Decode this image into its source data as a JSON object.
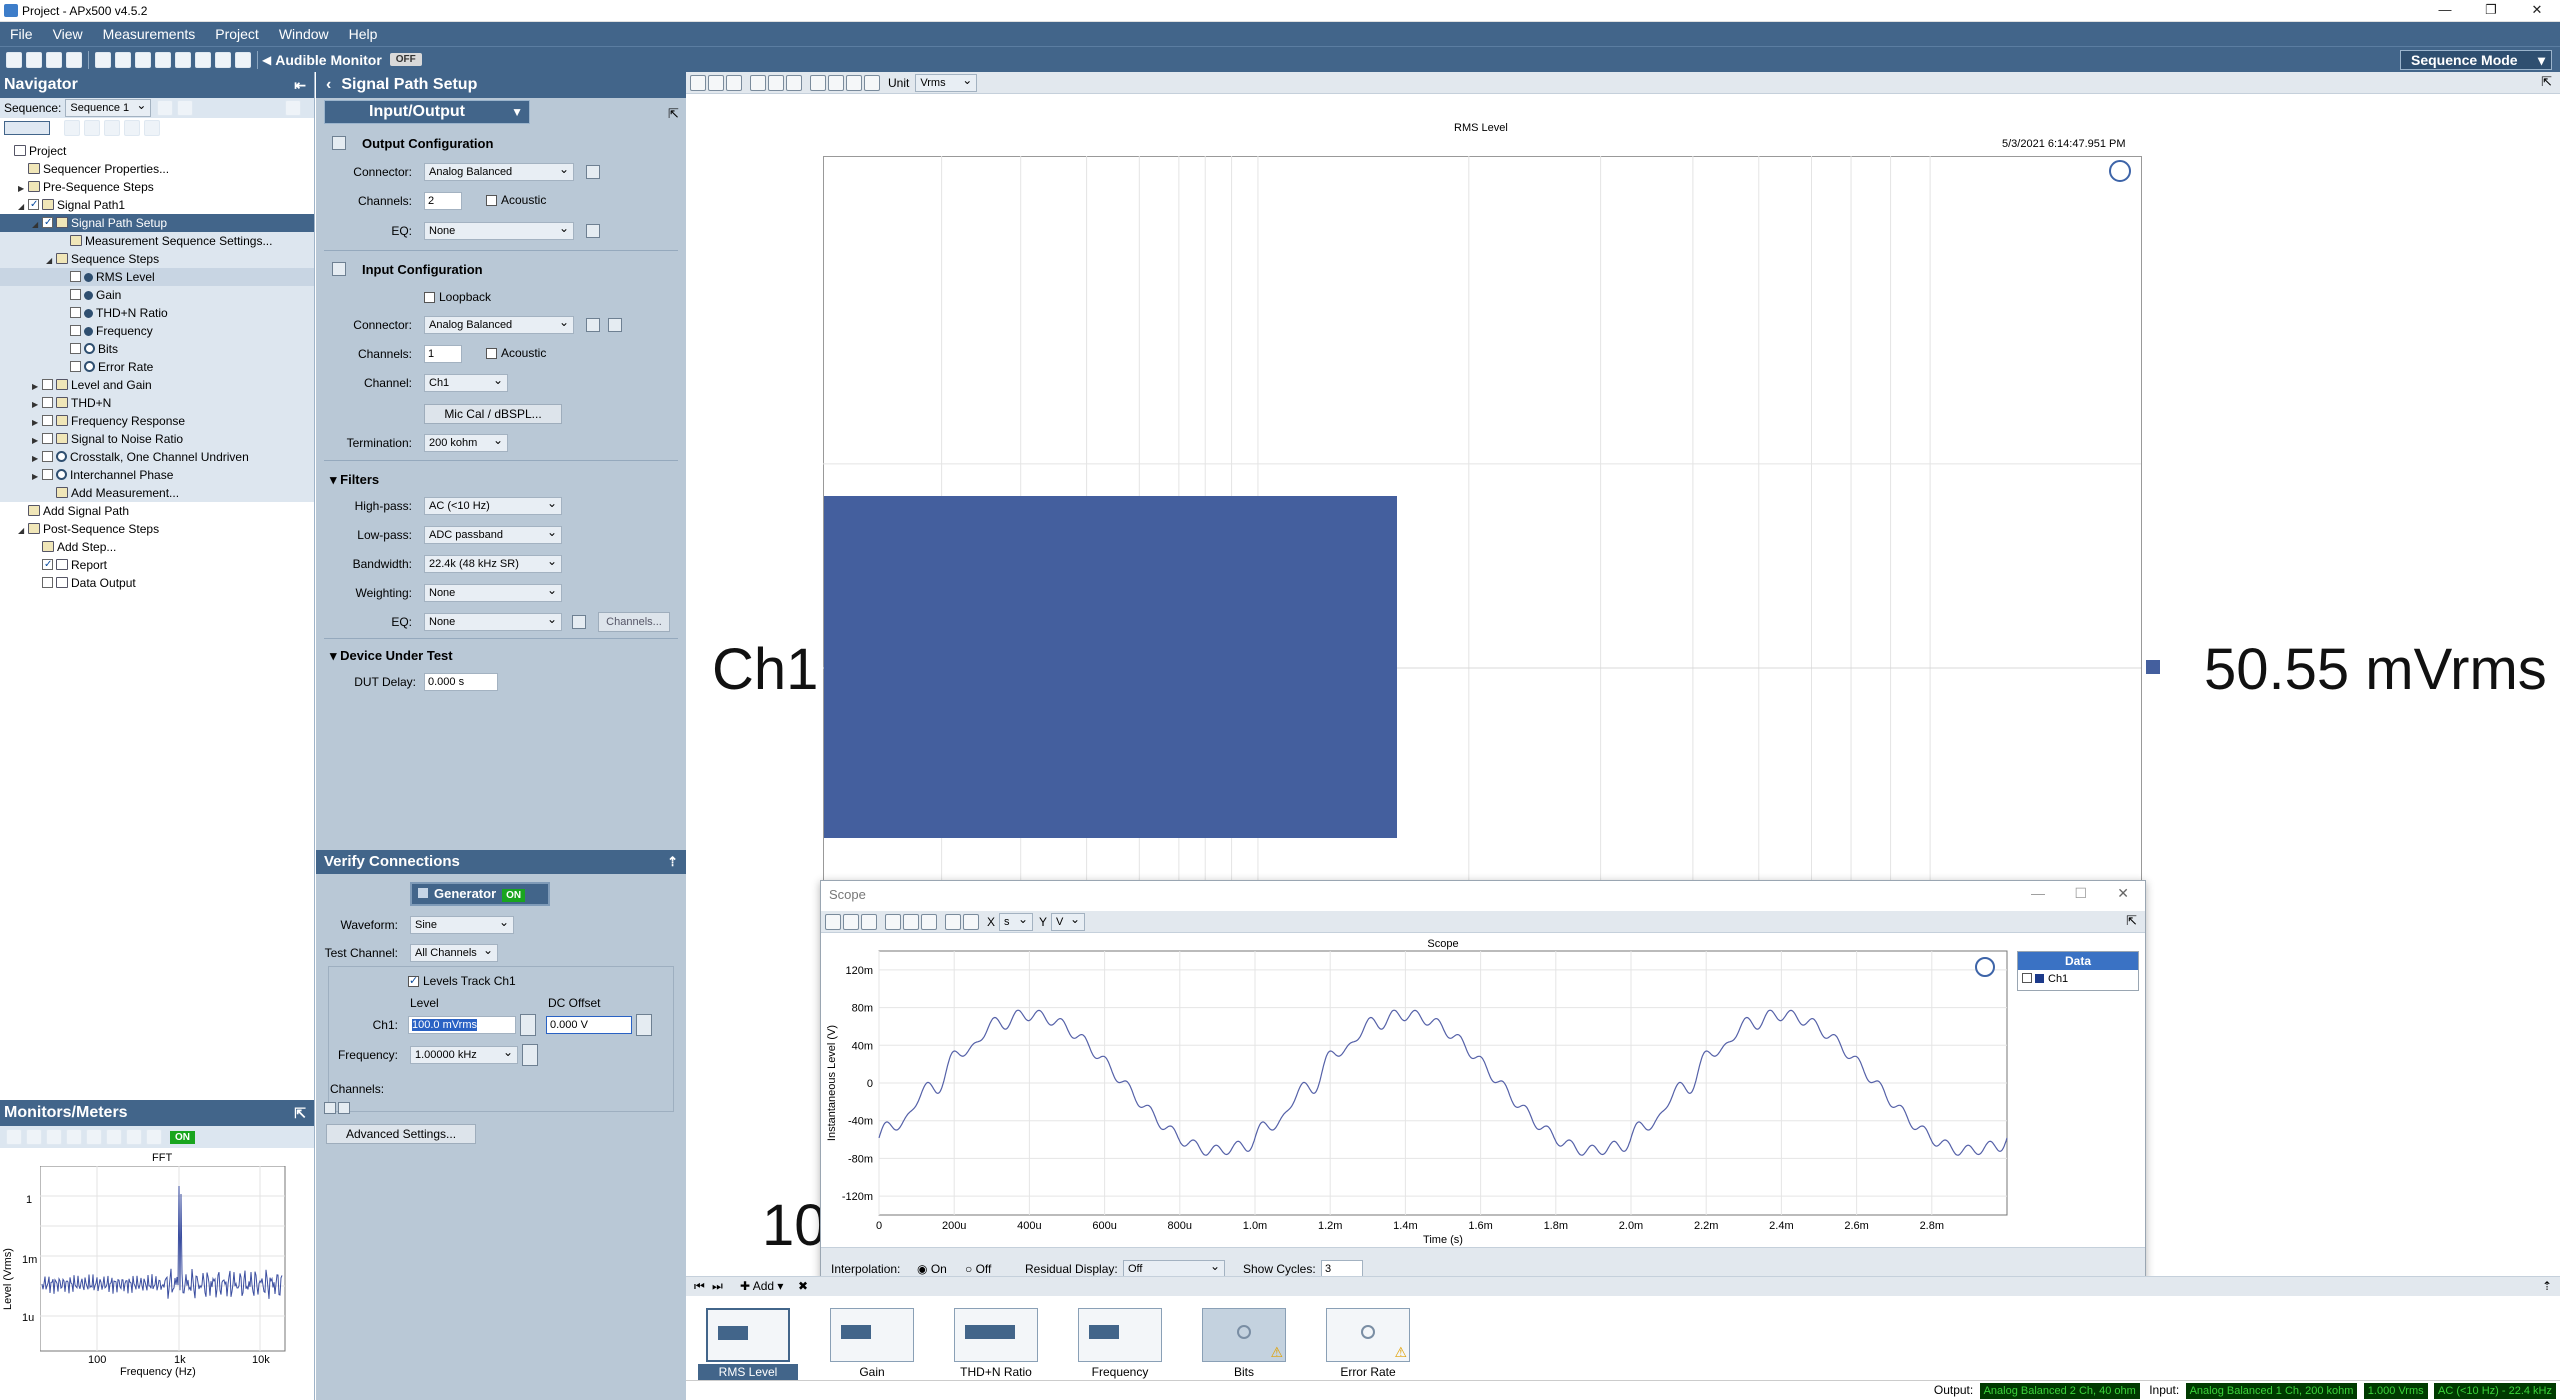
{
  "window": {
    "title": "Project - APx500 v4.5.2",
    "min": "—",
    "max": "❐",
    "close": "✕"
  },
  "menu": [
    "File",
    "View",
    "Measurements",
    "Project",
    "Window",
    "Help"
  ],
  "toolbar": {
    "audible_monitor": "Audible Monitor",
    "audible_state": "OFF",
    "mode": "Sequence Mode"
  },
  "navigator": {
    "title": "Navigator",
    "sequence_label": "Sequence:",
    "sequence_value": "Sequence 1",
    "tree": [
      {
        "label": "Project",
        "indent": 0,
        "arrow": "",
        "cb": false,
        "icon": "page"
      },
      {
        "label": "Sequencer Properties...",
        "indent": 1,
        "arrow": "",
        "cb": false,
        "icon": "gear"
      },
      {
        "label": "Pre-Sequence Steps",
        "indent": 1,
        "arrow": "▶",
        "cb": false,
        "icon": "folder"
      },
      {
        "label": "Signal Path1",
        "indent": 1,
        "arrow": "◢",
        "cb": true,
        "icon": "folder"
      },
      {
        "label": "Signal Path Setup",
        "indent": 2,
        "arrow": "◢",
        "cb": true,
        "icon": "folder",
        "state": "sel"
      },
      {
        "label": "Measurement Sequence Settings...",
        "indent": 4,
        "arrow": "",
        "cb": false,
        "icon": "gear",
        "state": "tinted"
      },
      {
        "label": "Sequence Steps",
        "indent": 3,
        "arrow": "◢",
        "cb": false,
        "icon": "folder",
        "state": "tinted"
      },
      {
        "label": "RMS Level",
        "indent": 4,
        "arrow": "",
        "cb": true,
        "icon": "dot",
        "state": "hl"
      },
      {
        "label": "Gain",
        "indent": 4,
        "arrow": "",
        "cb": true,
        "icon": "dot",
        "state": "tinted"
      },
      {
        "label": "THD+N Ratio",
        "indent": 4,
        "arrow": "",
        "cb": true,
        "icon": "dot",
        "state": "tinted"
      },
      {
        "label": "Frequency",
        "indent": 4,
        "arrow": "",
        "cb": true,
        "icon": "dot",
        "state": "tinted"
      },
      {
        "label": "Bits",
        "indent": 4,
        "arrow": "",
        "cb": true,
        "icon": "no",
        "state": "tinted"
      },
      {
        "label": "Error Rate",
        "indent": 4,
        "arrow": "",
        "cb": true,
        "icon": "no",
        "state": "tinted"
      },
      {
        "label": "Level and Gain",
        "indent": 2,
        "arrow": "▶",
        "cb": true,
        "icon": "folder",
        "state": "tinted"
      },
      {
        "label": "THD+N",
        "indent": 2,
        "arrow": "▶",
        "cb": true,
        "icon": "folder",
        "state": "tinted"
      },
      {
        "label": "Frequency Response",
        "indent": 2,
        "arrow": "▶",
        "cb": true,
        "icon": "folder",
        "state": "tinted"
      },
      {
        "label": "Signal to Noise Ratio",
        "indent": 2,
        "arrow": "▶",
        "cb": true,
        "icon": "folder",
        "state": "tinted"
      },
      {
        "label": "Crosstalk, One Channel Undriven",
        "indent": 2,
        "arrow": "▶",
        "cb": true,
        "icon": "no",
        "state": "tinted"
      },
      {
        "label": "Interchannel Phase",
        "indent": 2,
        "arrow": "▶",
        "cb": true,
        "icon": "no",
        "state": "tinted"
      },
      {
        "label": "Add Measurement...",
        "indent": 3,
        "arrow": "",
        "cb": false,
        "icon": "gear",
        "state": "tinted"
      },
      {
        "label": "Add Signal Path",
        "indent": 1,
        "arrow": "",
        "cb": false,
        "icon": "gear"
      },
      {
        "label": "Post-Sequence Steps",
        "indent": 1,
        "arrow": "◢",
        "cb": false,
        "icon": "folder"
      },
      {
        "label": "Add Step...",
        "indent": 2,
        "arrow": "",
        "cb": false,
        "icon": "gear"
      },
      {
        "label": "Report",
        "indent": 2,
        "arrow": "",
        "cb": true,
        "icon": "page"
      },
      {
        "label": "Data Output",
        "indent": 2,
        "arrow": "",
        "cb": true,
        "icon": "page"
      }
    ]
  },
  "monitors": {
    "title": "Monitors/Meters",
    "on": "ON",
    "fft_title": "FFT",
    "ylabel": "Level (Vrms)",
    "xlabel": "Frequency (Hz)",
    "yticks": [
      "1",
      "1m",
      "1u"
    ],
    "xticks": [
      "100",
      "1k",
      "10k"
    ]
  },
  "sps": {
    "title": "Signal Path Setup",
    "section": "Input/Output",
    "output": {
      "title": "Output Configuration",
      "connector_label": "Connector:",
      "connector": "Analog Balanced",
      "channels_label": "Channels:",
      "channels": "2",
      "acoustic": "Acoustic",
      "eq_label": "EQ:",
      "eq": "None"
    },
    "input": {
      "title": "Input Configuration",
      "loopback": "Loopback",
      "connector_label": "Connector:",
      "connector": "Analog Balanced",
      "channels_label": "Channels:",
      "channels": "1",
      "acoustic": "Acoustic",
      "channel_label": "Channel:",
      "channel": "Ch1",
      "mic_cal": "Mic Cal / dBSPL...",
      "termination_label": "Termination:",
      "termination": "200 kohm"
    },
    "filters": {
      "title": "Filters",
      "highpass_label": "High-pass:",
      "highpass": "AC (<10 Hz)",
      "lowpass_label": "Low-pass:",
      "lowpass": "ADC passband",
      "bandwidth_label": "Bandwidth:",
      "bandwidth": "22.4k (48 kHz SR)",
      "weighting_label": "Weighting:",
      "weighting": "None",
      "eq_label": "EQ:",
      "eq": "None",
      "channels_btn": "Channels..."
    },
    "dut": {
      "title": "Device Under Test",
      "delay_label": "DUT Delay:",
      "delay": "0.000 s"
    }
  },
  "verify": {
    "title": "Verify Connections",
    "generator": "Generator",
    "gen_state": "ON",
    "waveform_label": "Waveform:",
    "waveform": "Sine",
    "test_channel_label": "Test Channel:",
    "test_channel": "All Channels",
    "levels_track": "Levels Track Ch1",
    "level_hdr": "Level",
    "dcoffset_hdr": "DC Offset",
    "ch1_label": "Ch1:",
    "ch1_level": "100.0 mVrms",
    "ch1_dc": "0.000 V",
    "frequency_label": "Frequency:",
    "frequency": "1.00000 kHz",
    "channels_label": "Channels:",
    "advanced": "Advanced Settings..."
  },
  "rms": {
    "unit_label": "Unit",
    "unit": "Vrms",
    "title": "RMS Level",
    "timestamp": "5/3/2021 6:14:47.951 PM",
    "channel": "Ch1",
    "value": "50.55",
    "value_unit": "mVrms",
    "partial": "10",
    "bar_color": "#445f9e"
  },
  "scope": {
    "title": "Scope",
    "x_label": "X",
    "x_unit": "s",
    "y_label": "Y",
    "y_unit": "V",
    "legend_title": "Data",
    "legend_item": "Ch1",
    "interp_label": "Interpolation:",
    "interp_on": "On",
    "interp_off": "Off",
    "residual_label": "Residual Display:",
    "residual": "Off",
    "cycles_label": "Show Cycles:",
    "cycles": "3"
  },
  "chart_data": {
    "type": "line",
    "title": "Scope",
    "xlabel": "Time (s)",
    "ylabel": "Instantaneous Level (V)",
    "xlim": [
      0,
      0.003
    ],
    "ylim": [
      -140,
      140
    ],
    "xticks": [
      "0",
      "200u",
      "400u",
      "600u",
      "800u",
      "1.0m",
      "1.2m",
      "1.4m",
      "1.6m",
      "1.8m",
      "2.0m",
      "2.2m",
      "2.4m",
      "2.6m",
      "2.8m"
    ],
    "yticks": [
      "120m",
      "80m",
      "40m",
      "0",
      "-40m",
      "-80m",
      "-120m"
    ],
    "series": [
      {
        "name": "Ch1",
        "color": "#5561a8",
        "amplitude_mV": 72,
        "frequency_hz": 1000,
        "x_start": 0.00015
      }
    ]
  },
  "thumbs": [
    {
      "label": "RMS Level",
      "sel": true
    },
    {
      "label": "Gain"
    },
    {
      "label": "THD+N Ratio"
    },
    {
      "label": "Frequency"
    },
    {
      "label": "Bits",
      "warn": true
    },
    {
      "label": "Error Rate",
      "warn": true
    }
  ],
  "thumbbar": {
    "add": "Add"
  },
  "status": {
    "output_label": "Output:",
    "output": "Analog Balanced 2 Ch, 40 ohm",
    "input_label": "Input:",
    "input": "Analog Balanced 1 Ch, 200 kohm",
    "level": "1.000 Vrms",
    "filter": "AC (<10 Hz) - 22.4 kHz"
  }
}
